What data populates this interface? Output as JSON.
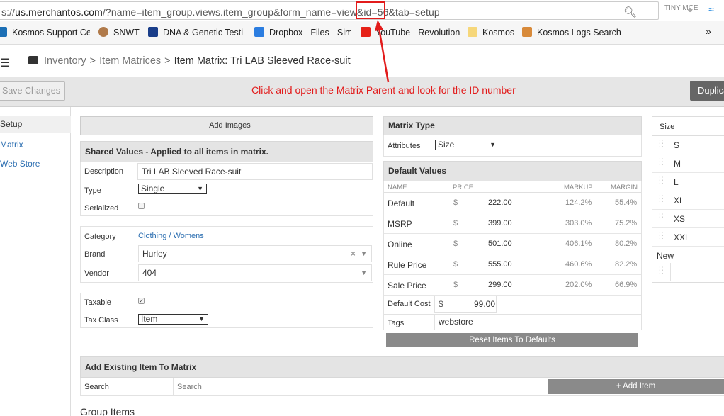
{
  "browser": {
    "url_prefix": "s://",
    "url_host": "us.merchantos.com",
    "url_path": "/?name=item_group.views.item_group&form_name=view&id=56&tab=setup",
    "url_path_a": "/?name=item_group.views.item_group&form_name=view&",
    "url_highlight": "id=56",
    "url_path_b": "&tab=setup",
    "ext_tinymce": "TINY MCE",
    "bookmarks": [
      {
        "label": "Kosmos Support Cen",
        "color": "#1c6fb5"
      },
      {
        "label": "SNWT",
        "color": "#b07a4a"
      },
      {
        "label": "DNA & Genetic Testi",
        "color": "#1a3e8a"
      },
      {
        "label": "Dropbox - Files - Sim",
        "color": "#2b7de0"
      },
      {
        "label": "YouTube - Revolution",
        "color": "#e62117"
      },
      {
        "label": "Kosmos",
        "color": "#f6d77a"
      },
      {
        "label": "Kosmos Logs Search",
        "color": "#d88a3a"
      }
    ],
    "bookmarks_more": "»"
  },
  "breadcrumb": {
    "items": [
      "Inventory",
      "Item Matrices"
    ],
    "current": "Item Matrix:  Tri LAB Sleeved Race-suit",
    "sep": ">"
  },
  "toolbar": {
    "save_label": "Save Changes",
    "annotation": "Click and open the Matrix Parent and look for the ID number",
    "duplicate_label": "Duplica"
  },
  "sidenav": {
    "items": [
      "Setup",
      "Matrix",
      "Web Store"
    ]
  },
  "left": {
    "add_images": "+ Add Images",
    "shared_header": "Shared Values - Applied to all items in matrix.",
    "description_label": "Description",
    "description_value": "Tri LAB Sleeved Race-suit",
    "type_label": "Type",
    "type_value": "Single",
    "serialized_label": "Serialized",
    "category_label": "Category",
    "category_value": "Clothing / Womens",
    "brand_label": "Brand",
    "brand_value": "Hurley",
    "vendor_label": "Vendor",
    "vendor_value": "404",
    "taxable_label": "Taxable",
    "taxclass_label": "Tax Class",
    "taxclass_value": "Item",
    "add_existing_header": "Add Existing Item To Matrix",
    "search_label": "Search",
    "search_placeholder": "Search",
    "add_item_label": "+ Add Item",
    "group_items_header": "Group Items"
  },
  "matrix": {
    "type_header": "Matrix Type",
    "attributes_label": "Attributes",
    "attributes_value": "Size",
    "defaults_header": "Default Values",
    "columns": {
      "name": "NAME",
      "price": "PRICE",
      "markup": "MARKUP",
      "margin": "MARGIN"
    },
    "rows": [
      {
        "name": "Default",
        "currency": "$",
        "price": "222.00",
        "markup": "124.2%",
        "margin": "55.4%"
      },
      {
        "name": "MSRP",
        "currency": "$",
        "price": "399.00",
        "markup": "303.0%",
        "margin": "75.2%"
      },
      {
        "name": "Online",
        "currency": "$",
        "price": "501.00",
        "markup": "406.1%",
        "margin": "80.2%"
      },
      {
        "name": "Rule Price",
        "currency": "$",
        "price": "555.00",
        "markup": "460.6%",
        "margin": "82.2%"
      },
      {
        "name": "Sale Price",
        "currency": "$",
        "price": "299.00",
        "markup": "202.0%",
        "margin": "66.9%"
      }
    ],
    "default_cost_label": "Default Cost",
    "default_cost_currency": "$",
    "default_cost_value": "99.00",
    "tags_label": "Tags",
    "tags_value": "webstore",
    "reset_label": "Reset Items To Defaults"
  },
  "sizes": {
    "header": "Size",
    "values": [
      "S",
      "M",
      "L",
      "XL",
      "XS",
      "XXL"
    ],
    "new_label": "New"
  }
}
